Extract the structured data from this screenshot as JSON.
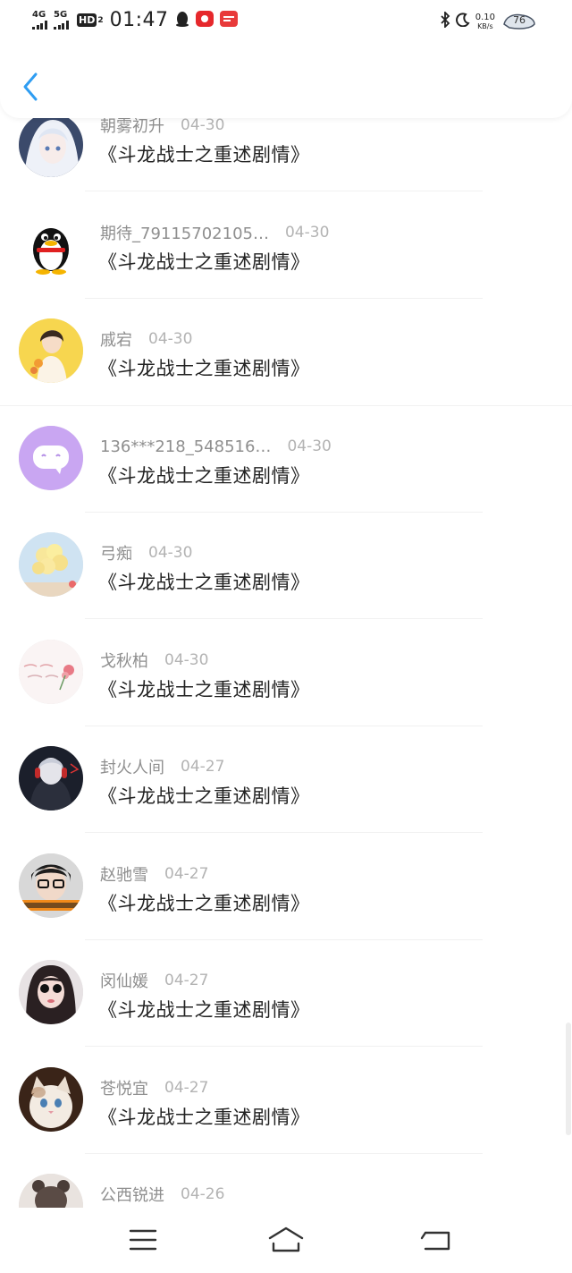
{
  "status_bar": {
    "network_1": "4G",
    "network_2": "5G",
    "hd_label": "HD",
    "hd_sub": "2",
    "time": "01:47",
    "speed_value": "0.10",
    "speed_unit": "KB/s",
    "battery_level": "76"
  },
  "header": {
    "back_icon": "chevron-left-icon"
  },
  "comments": [
    {
      "name": "朝雾初升",
      "date": "04-30",
      "title": "《斗龙战士之重述剧情》",
      "avatar": "anime-girl-avatar"
    },
    {
      "name": "期待_79115702105…",
      "date": "04-30",
      "title": "《斗龙战士之重述剧情》",
      "avatar": "qq-penguin-avatar"
    },
    {
      "name": "戚宕",
      "date": "04-30",
      "title": "《斗龙战士之重述剧情》",
      "avatar": "girl-flowers-avatar"
    },
    {
      "name": "136***218_548516…",
      "date": "04-30",
      "title": "《斗龙战士之重述剧情》",
      "avatar": "chat-bubble-avatar"
    },
    {
      "name": "弓痴",
      "date": "04-30",
      "title": "《斗龙战士之重述剧情》",
      "avatar": "balloons-avatar"
    },
    {
      "name": "戈秋柏",
      "date": "04-30",
      "title": "《斗龙战士之重述剧情》",
      "avatar": "rose-text-avatar"
    },
    {
      "name": "封火人间",
      "date": "04-27",
      "title": "《斗龙战士之重述剧情》",
      "avatar": "anime-headphones-avatar"
    },
    {
      "name": "赵驰雪",
      "date": "04-27",
      "title": "《斗龙战士之重述剧情》",
      "avatar": "boy-glasses-avatar"
    },
    {
      "name": "闵仙媛",
      "date": "04-27",
      "title": "《斗龙战士之重述剧情》",
      "avatar": "girl-sunglasses-avatar"
    },
    {
      "name": "苍悦宜",
      "date": "04-27",
      "title": "《斗龙战士之重述剧情》",
      "avatar": "cat-avatar"
    },
    {
      "name": "公西锐进",
      "date": "04-26",
      "title": "",
      "avatar": "bear-avatar"
    }
  ],
  "nav_bar": {
    "menu_icon": "menu-icon",
    "home_icon": "home-icon",
    "back_icon": "back-icon"
  },
  "colors": {
    "accent": "#2f9df2",
    "name_text": "#8f8f8f",
    "date_text": "#b3b3b3",
    "title_text": "#222222"
  }
}
